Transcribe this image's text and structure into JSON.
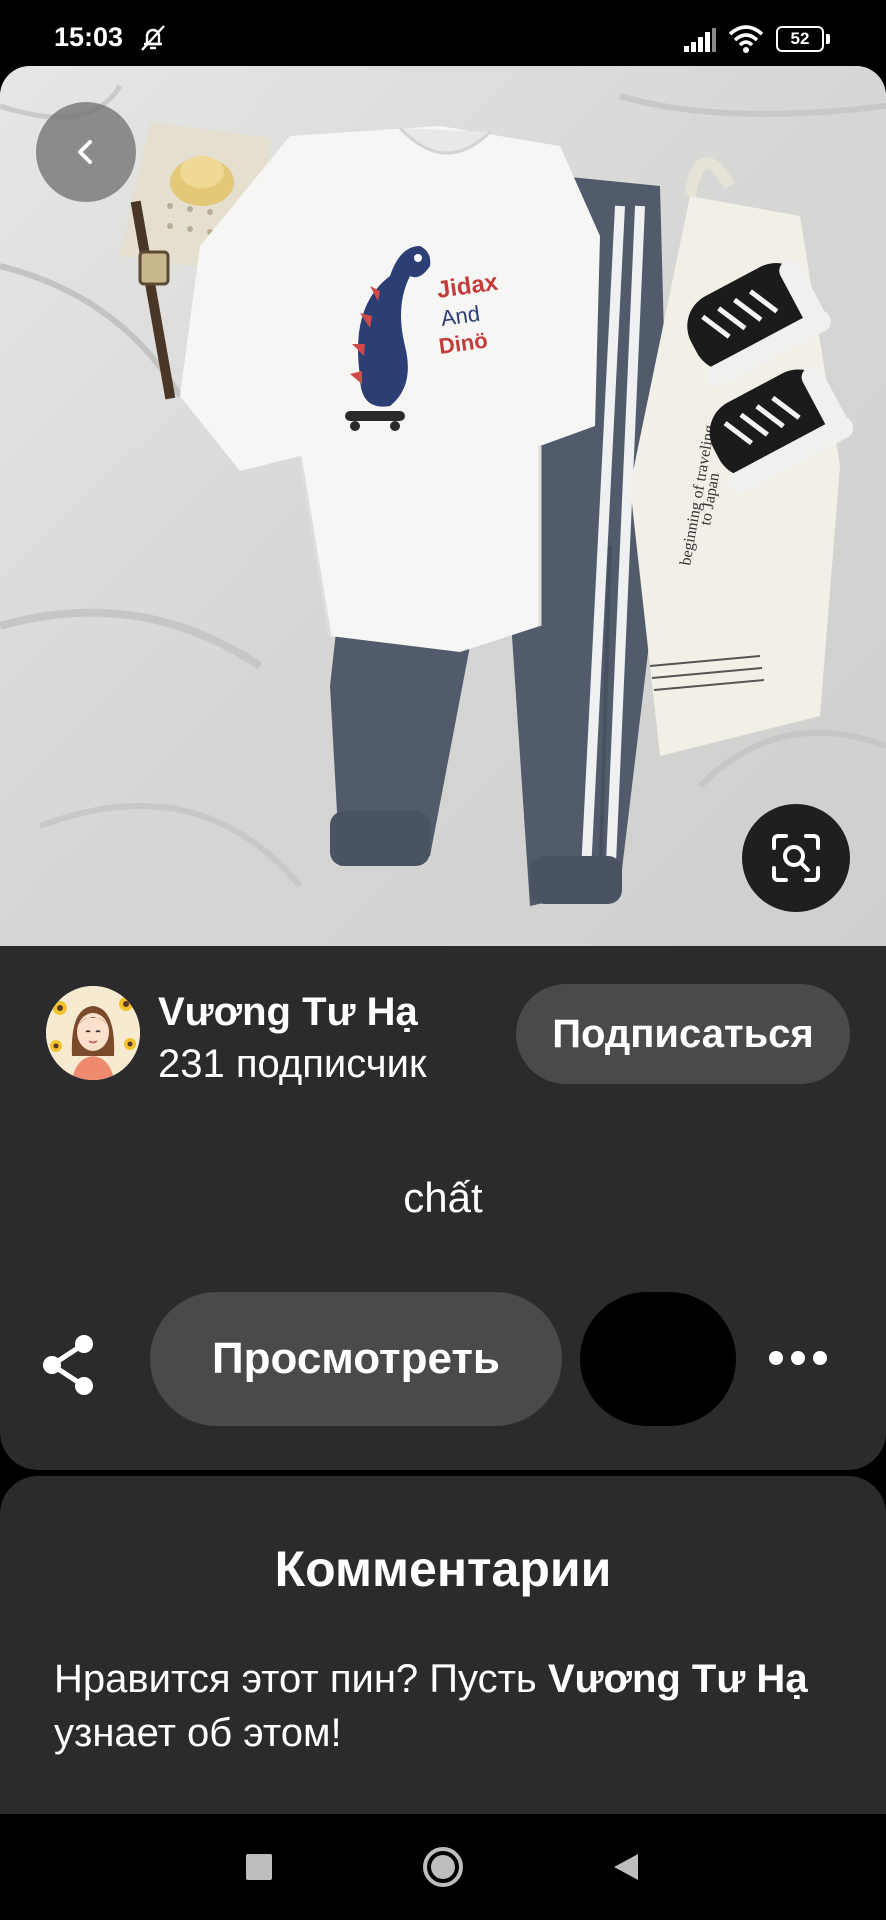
{
  "status_bar": {
    "time": "15:03",
    "battery": "52",
    "icons": [
      "mute-icon",
      "signal-icon",
      "wifi-icon",
      "battery-icon"
    ]
  },
  "pin": {
    "image_buttons": {
      "back": "chevron-left-icon",
      "visual_search": "lens-search-icon"
    },
    "author": {
      "name": "Vương Tư Hạ",
      "followers": "231 подписчик"
    },
    "follow_label": "Подписаться",
    "description": "chất",
    "view_label": "Просмотреть",
    "actions": [
      "share-icon",
      "more-icon"
    ]
  },
  "comments": {
    "title": "Комментарии",
    "prompt_start": "Нравится этот пин? Пусть ",
    "prompt_name": "Vương Tư Hạ",
    "prompt_end": " узнает об этом!"
  },
  "colors": {
    "panel": "#2b2a2c",
    "button": "#4a494b",
    "background": "#000000"
  }
}
